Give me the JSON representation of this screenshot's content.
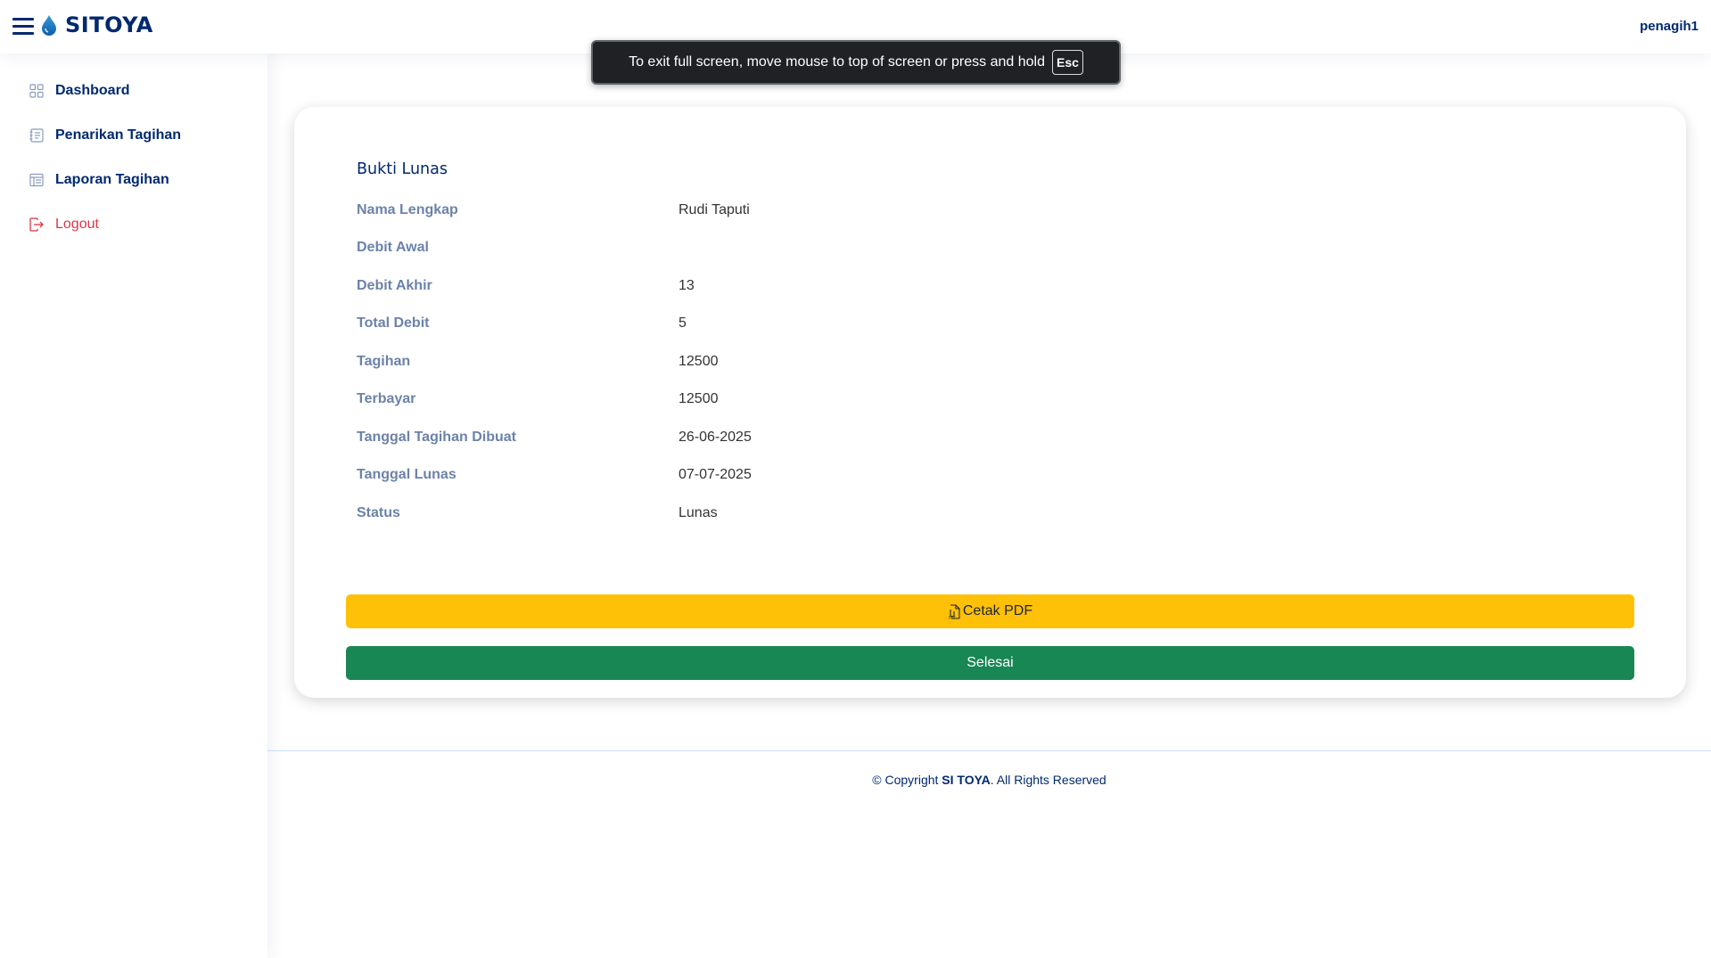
{
  "header": {
    "brand": "SITOYA",
    "user": "penagih1"
  },
  "sidebar": {
    "items": [
      {
        "label": "Dashboard",
        "icon": "grid-icon"
      },
      {
        "label": "Penarikan Tagihan",
        "icon": "journal-icon"
      },
      {
        "label": "Laporan Tagihan",
        "icon": "table-icon"
      },
      {
        "label": "Logout",
        "icon": "box-arrow-right-icon"
      }
    ]
  },
  "fullscreen_notice": {
    "message": "To exit full screen, move mouse to top of screen or press and hold",
    "key": "Esc"
  },
  "card": {
    "title": "Bukti Lunas",
    "rows": [
      {
        "label": "Nama Lengkap",
        "value": "Rudi Taputi"
      },
      {
        "label": "Debit Awal",
        "value": ""
      },
      {
        "label": "Debit Akhir",
        "value": "13"
      },
      {
        "label": "Total Debit",
        "value": "5"
      },
      {
        "label": "Tagihan",
        "value": "12500"
      },
      {
        "label": "Terbayar",
        "value": "12500"
      },
      {
        "label": "Tanggal Tagihan Dibuat",
        "value": "26-06-2025"
      },
      {
        "label": "Tanggal Lunas",
        "value": "07-07-2025"
      },
      {
        "label": "Status",
        "value": "Lunas"
      }
    ],
    "print_button": "Cetak PDF",
    "done_button": "Selesai"
  },
  "footer": {
    "prefix": "© Copyright ",
    "brand": "SI TOYA",
    "suffix": ". All Rights Reserved"
  },
  "colors": {
    "primary": "#012970",
    "label": "#6c82a9",
    "warning": "#ffc107",
    "success": "#198754",
    "danger": "#dc3545"
  }
}
